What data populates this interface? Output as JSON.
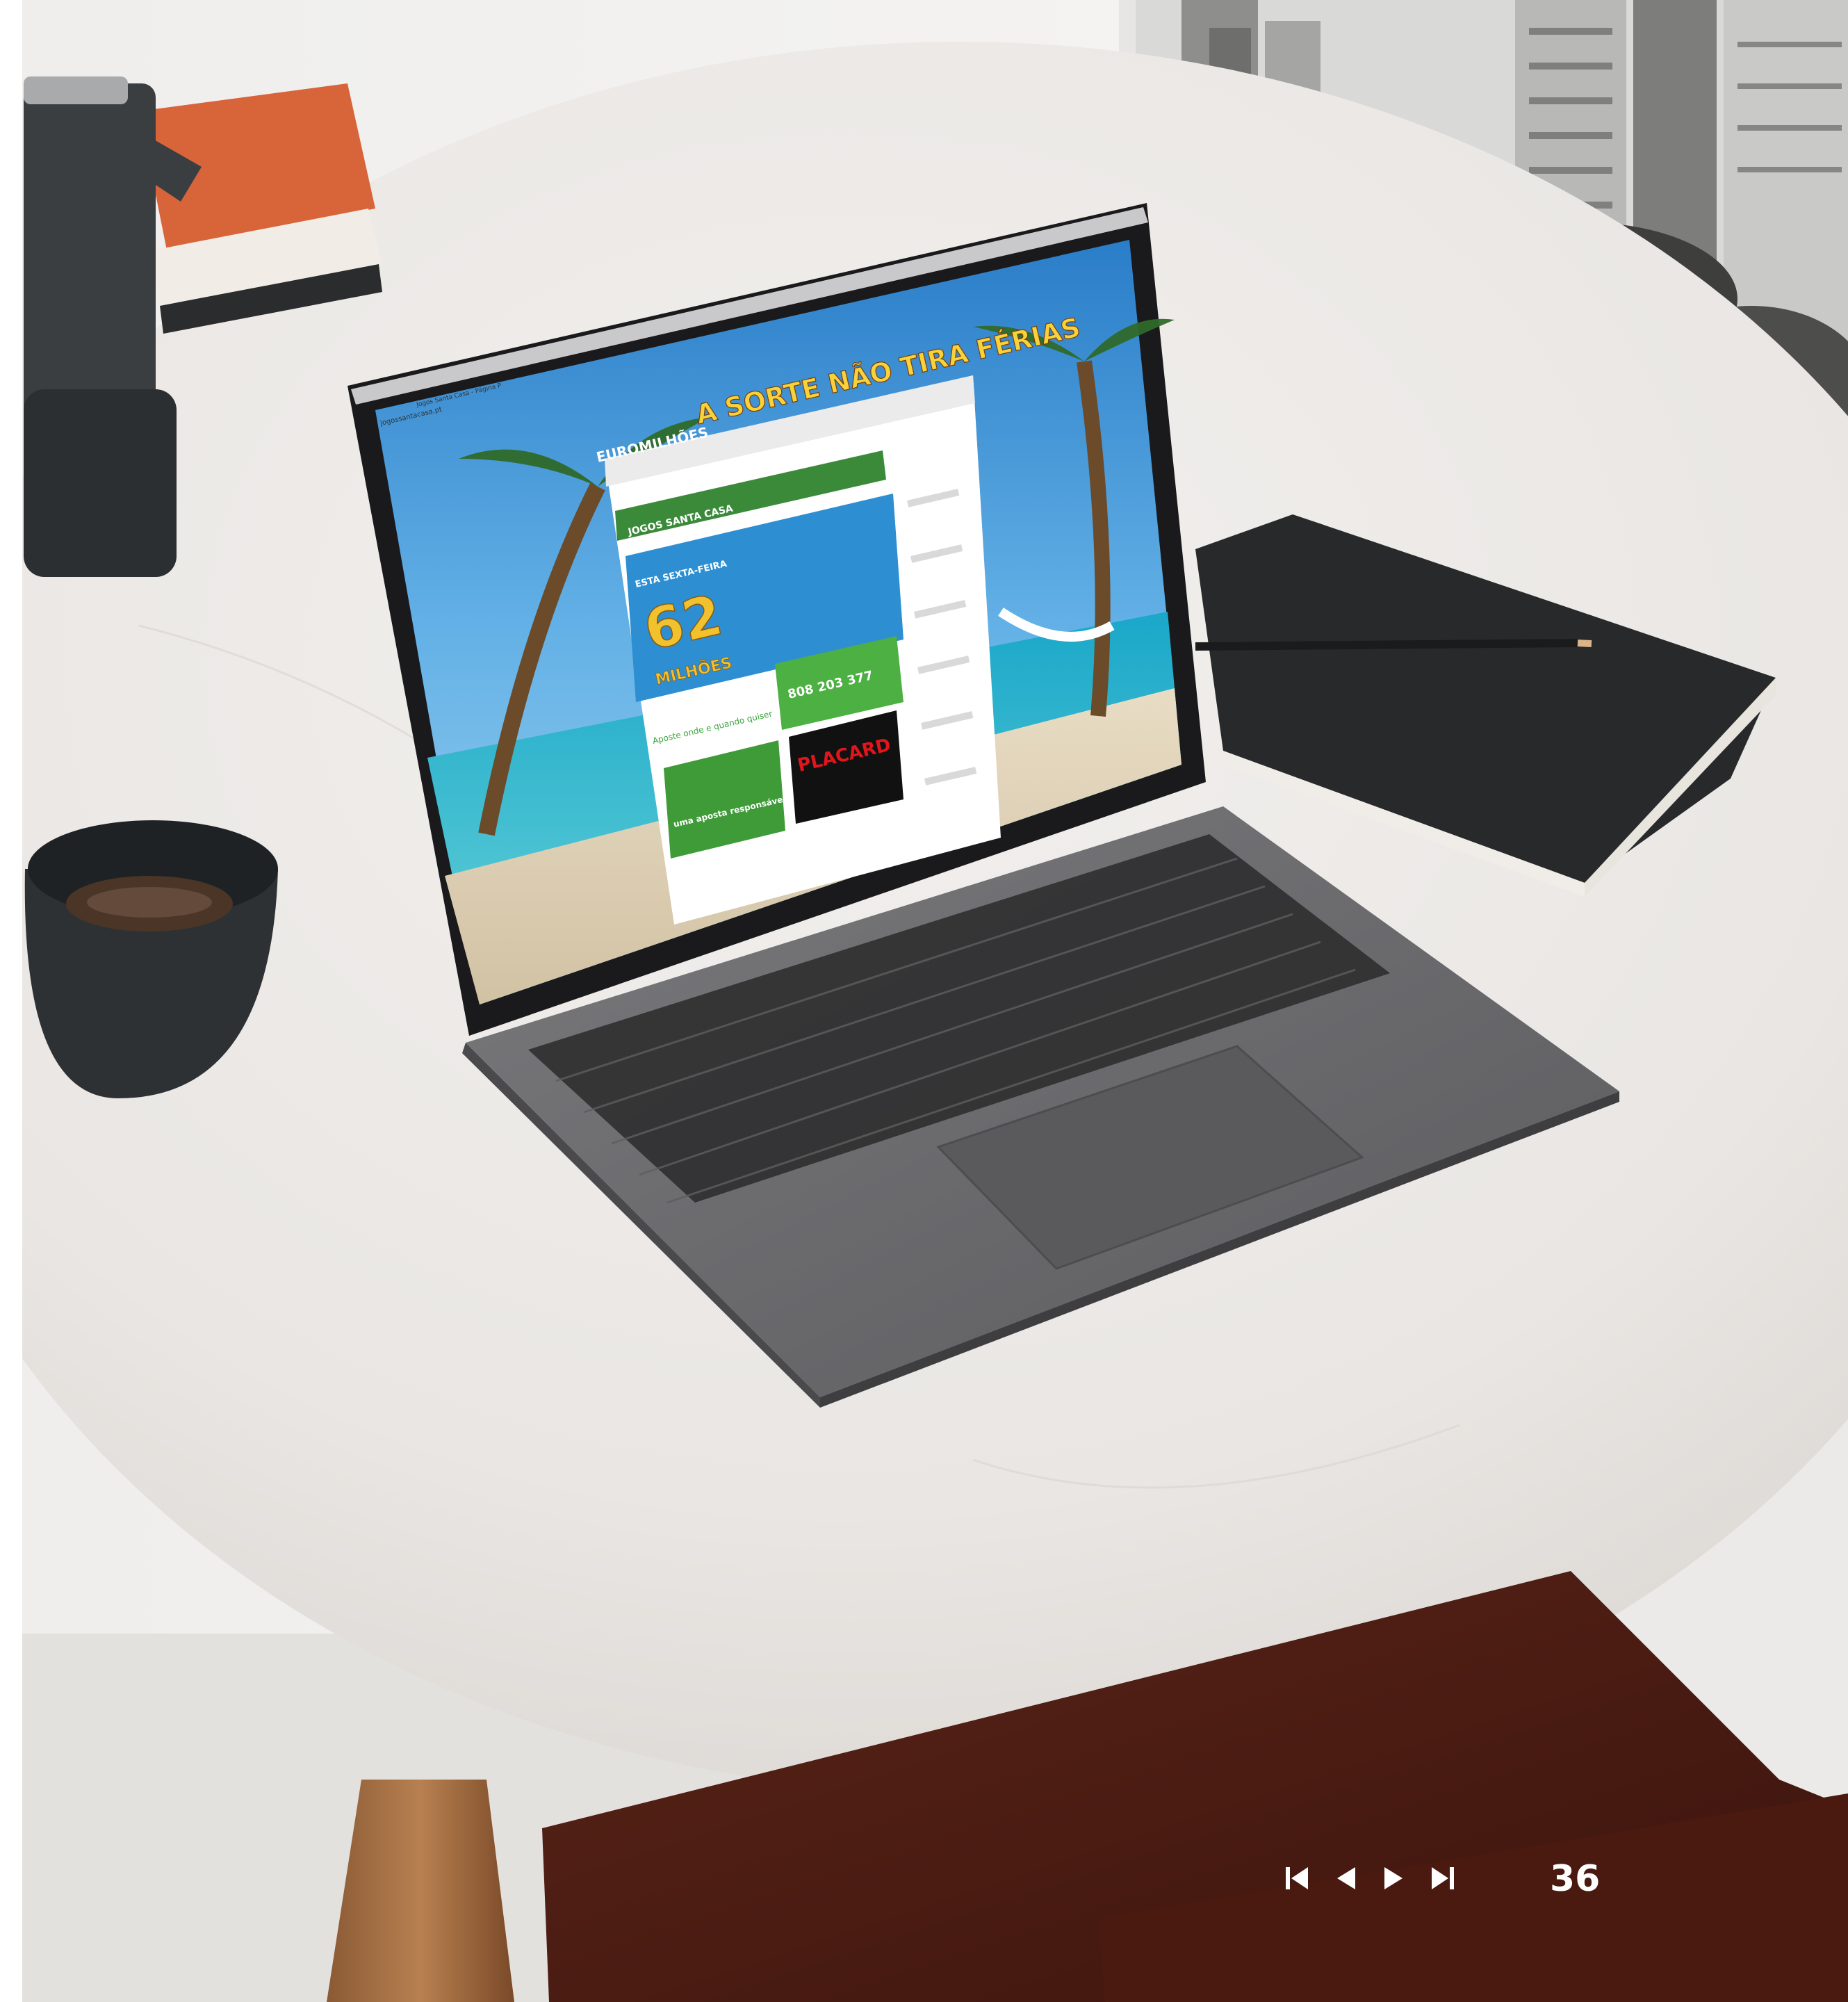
{
  "colors": {
    "table": "#ebe8e5",
    "wall": "#f3f2f0",
    "laptop_body": "#6d6d70",
    "nav": "#ffffff"
  },
  "laptop_screen": {
    "browser_tab": "Jogos Santa Casa - Página P",
    "url": "jogossantacasa.pt",
    "hero_headline": "A SORTE NÃO TIRA FÉRIAS",
    "brand": "EUROMILHÕES",
    "site_logo": "JOGOS SANTA CASA",
    "promo_label": "ESTA SEXTA-FEIRA",
    "jackpot_amount": "62",
    "jackpot_unit": "MILHÕES",
    "slogan": "Aposte onde e quando quiser",
    "phone": "808 203 377",
    "responsible_badge": "uma aposta responsável",
    "placard": "PLACARD"
  },
  "navigation": {
    "icons": [
      "first-page-icon",
      "previous-page-icon",
      "next-page-icon",
      "last-page-icon"
    ]
  },
  "page_number": "36"
}
